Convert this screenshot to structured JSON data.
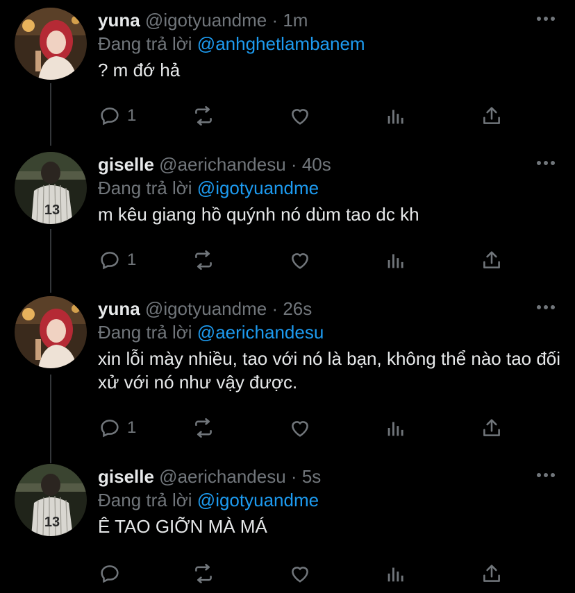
{
  "colors": {
    "background": "#000000",
    "text": "#e7e9ea",
    "muted": "#71767b",
    "link": "#1d9bf0"
  },
  "tweets": [
    {
      "name": "yuna",
      "handle": "@igotyuandme",
      "dot": "·",
      "time": "1m",
      "reply_prefix": "Đang trả lời",
      "reply_to": "@anhghetlambanem",
      "text": "? m đớ hả",
      "reply_count": "1",
      "avatar": "avatar-yuna"
    },
    {
      "name": "giselle",
      "handle": "@aerichandesu",
      "dot": "·",
      "time": "40s",
      "reply_prefix": "Đang trả lời",
      "reply_to": "@igotyuandme",
      "text": "m kêu giang hồ quýnh nó dùm tao dc kh",
      "reply_count": "1",
      "avatar": "avatar-giselle"
    },
    {
      "name": "yuna",
      "handle": "@igotyuandme",
      "dot": "·",
      "time": "26s",
      "reply_prefix": "Đang trả lời",
      "reply_to": "@aerichandesu",
      "text": "xin lỗi mày nhiều, tao với nó là bạn, không thể nào tao đối xử với nó như vậy được.",
      "reply_count": "1",
      "avatar": "avatar-yuna"
    },
    {
      "name": "giselle",
      "handle": "@aerichandesu",
      "dot": "·",
      "time": "5s",
      "reply_prefix": "Đang trả lời",
      "reply_to": "@igotyuandme",
      "text": "Ê TAO GIỠN MÀ MÁ",
      "reply_count": "",
      "avatar": "avatar-giselle"
    }
  ],
  "icons": [
    "reply-icon",
    "retweet-icon",
    "like-icon",
    "analytics-icon",
    "share-icon",
    "more-icon"
  ]
}
